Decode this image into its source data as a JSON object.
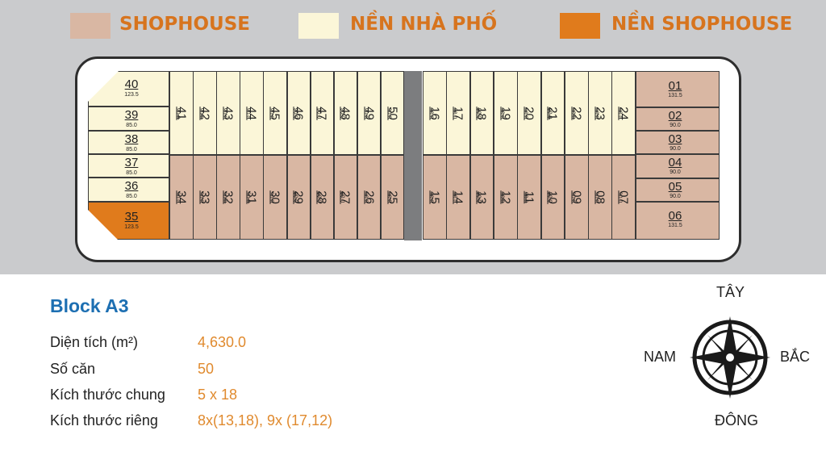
{
  "legend": [
    {
      "label": "SHOPHOUSE",
      "color": "#d9b7a3"
    },
    {
      "label": "NỀN NHÀ PHỐ",
      "color": "#fbf6d8"
    },
    {
      "label": "NỀN SHOPHOUSE",
      "color": "#e07b1c"
    }
  ],
  "map": {
    "left_column": [
      {
        "num": "40",
        "area": "123.5",
        "type": "nha_pho"
      },
      {
        "num": "39",
        "area": "85.0",
        "type": "nha_pho"
      },
      {
        "num": "38",
        "area": "85.0",
        "type": "nha_pho"
      },
      {
        "num": "37",
        "area": "85.0",
        "type": "nha_pho"
      },
      {
        "num": "36",
        "area": "85.0",
        "type": "nha_pho"
      },
      {
        "num": "35",
        "area": "123.5",
        "type": "nen_shophouse"
      }
    ],
    "left_top_row": [
      {
        "num": "41",
        "area": "90.0"
      },
      {
        "num": "42",
        "area": "90.0"
      },
      {
        "num": "43",
        "area": "90.0"
      },
      {
        "num": "44",
        "area": "90.0"
      },
      {
        "num": "45",
        "area": "90.0"
      },
      {
        "num": "46",
        "area": "90.0"
      },
      {
        "num": "47",
        "area": "90.0"
      },
      {
        "num": "48",
        "area": "90.0"
      },
      {
        "num": "49",
        "area": "90.0"
      },
      {
        "num": "50",
        "area": "90.0"
      }
    ],
    "left_bottom_row": [
      {
        "num": "34",
        "area": "90.0"
      },
      {
        "num": "33",
        "area": "90.0"
      },
      {
        "num": "32",
        "area": "90.0"
      },
      {
        "num": "31",
        "area": "90.0"
      },
      {
        "num": "30",
        "area": "90.0"
      },
      {
        "num": "29",
        "area": "90.0"
      },
      {
        "num": "28",
        "area": "90.0"
      },
      {
        "num": "27",
        "area": "90.0"
      },
      {
        "num": "26",
        "area": "90.0"
      },
      {
        "num": "25",
        "area": "90.0"
      }
    ],
    "right_top_row": [
      {
        "num": "16",
        "area": "90.0"
      },
      {
        "num": "17",
        "area": "90.0"
      },
      {
        "num": "18",
        "area": "90.0"
      },
      {
        "num": "19",
        "area": "90.0"
      },
      {
        "num": "20",
        "area": "90.0"
      },
      {
        "num": "21",
        "area": "90.0"
      },
      {
        "num": "22",
        "area": "90.0"
      },
      {
        "num": "23",
        "area": "90.0"
      },
      {
        "num": "24",
        "area": "90.0"
      }
    ],
    "right_bottom_row": [
      {
        "num": "15",
        "area": "90.0"
      },
      {
        "num": "14",
        "area": "90.0"
      },
      {
        "num": "13",
        "area": "90.0"
      },
      {
        "num": "12",
        "area": "90.0"
      },
      {
        "num": "11",
        "area": "90.0"
      },
      {
        "num": "10",
        "area": "90.0"
      },
      {
        "num": "09",
        "area": "90.0"
      },
      {
        "num": "08",
        "area": "90.0"
      },
      {
        "num": "07",
        "area": "90.0"
      }
    ],
    "right_column": [
      {
        "num": "01",
        "area": "131.5"
      },
      {
        "num": "02",
        "area": "90.0"
      },
      {
        "num": "03",
        "area": "90.0"
      },
      {
        "num": "04",
        "area": "90.0"
      },
      {
        "num": "05",
        "area": "90.0"
      },
      {
        "num": "06",
        "area": "131.5"
      }
    ]
  },
  "info": {
    "title": "Block A3",
    "rows": [
      {
        "label": "Diện tích (m²)",
        "value": "4,630.0"
      },
      {
        "label": "Số căn",
        "value": "50"
      },
      {
        "label": "Kích thước chung",
        "value": "5 x 18"
      },
      {
        "label": "Kích thước riêng",
        "value": "8x(13,18), 9x (17,12)"
      }
    ]
  },
  "compass": {
    "top": "TÂY",
    "left": "NAM",
    "right": "BẮC",
    "bottom": "ĐÔNG",
    "icon": "compass-rose-icon"
  }
}
